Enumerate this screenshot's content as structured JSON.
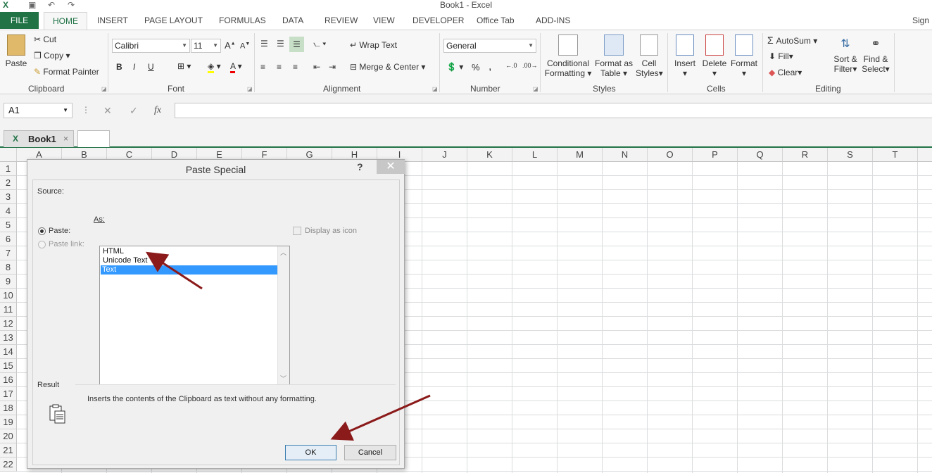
{
  "window": {
    "title": "Book1 - Excel",
    "signin": "Sign"
  },
  "tabs": [
    "FILE",
    "HOME",
    "INSERT",
    "PAGE LAYOUT",
    "FORMULAS",
    "DATA",
    "REVIEW",
    "VIEW",
    "DEVELOPER",
    "Office Tab",
    "ADD-INS"
  ],
  "clipboard": {
    "paste": "Paste",
    "cut": "Cut",
    "copy": "Copy",
    "format_painter": "Format Painter",
    "label": "Clipboard"
  },
  "font": {
    "name": "Calibri",
    "size": "11",
    "bold": "B",
    "italic": "I",
    "underline": "U",
    "label": "Font"
  },
  "alignment": {
    "wrap_text": "Wrap Text",
    "merge_center": "Merge & Center",
    "label": "Alignment"
  },
  "number": {
    "format": "General",
    "percent": "%",
    "comma": ",",
    "label": "Number"
  },
  "styles": {
    "conditional": "Conditional",
    "formatting": "Formatting",
    "format_as": "Format as",
    "table": "Table",
    "cell": "Cell",
    "cell_styles": "Styles",
    "label": "Styles"
  },
  "cells": {
    "insert": "Insert",
    "delete": "Delete",
    "format": "Format",
    "label": "Cells"
  },
  "editing": {
    "autosum": "AutoSum",
    "fill": "Fill",
    "clear": "Clear",
    "sort1": "Sort &",
    "sort2": "Filter",
    "find1": "Find &",
    "find2": "Select",
    "label": "Editing"
  },
  "formula_bar": {
    "name_box": "A1",
    "fx": "fx",
    "cancel": "✕",
    "enter": "✓"
  },
  "sheet_tab": {
    "name": "Book1"
  },
  "columns": [
    "A",
    "B",
    "C",
    "D",
    "E",
    "F",
    "G",
    "H",
    "I",
    "J",
    "K",
    "L",
    "M",
    "N",
    "O",
    "P",
    "Q",
    "R",
    "S",
    "T"
  ],
  "rows": [
    "1",
    "2",
    "3",
    "4",
    "5",
    "6",
    "7",
    "8",
    "9",
    "10",
    "11",
    "12",
    "13",
    "14",
    "15",
    "16",
    "17",
    "18",
    "19",
    "20",
    "21",
    "22"
  ],
  "dialog": {
    "title": "Paste Special",
    "help": "?",
    "source_label": "Source:",
    "as_label": "As:",
    "paste_label": "Paste:",
    "paste_link_label": "Paste link:",
    "display_as_icon": "Display as icon",
    "list_items": [
      "HTML",
      "Unicode Text",
      "Text"
    ],
    "selected_item": "Text",
    "result_label": "Result",
    "result_text": "Inserts the contents of the Clipboard as text without any formatting.",
    "ok": "OK",
    "cancel": "Cancel"
  },
  "colors": {
    "excel_green": "#217346",
    "selection_blue": "#3399ff",
    "annotation_arrow": "#8b1a1a"
  }
}
